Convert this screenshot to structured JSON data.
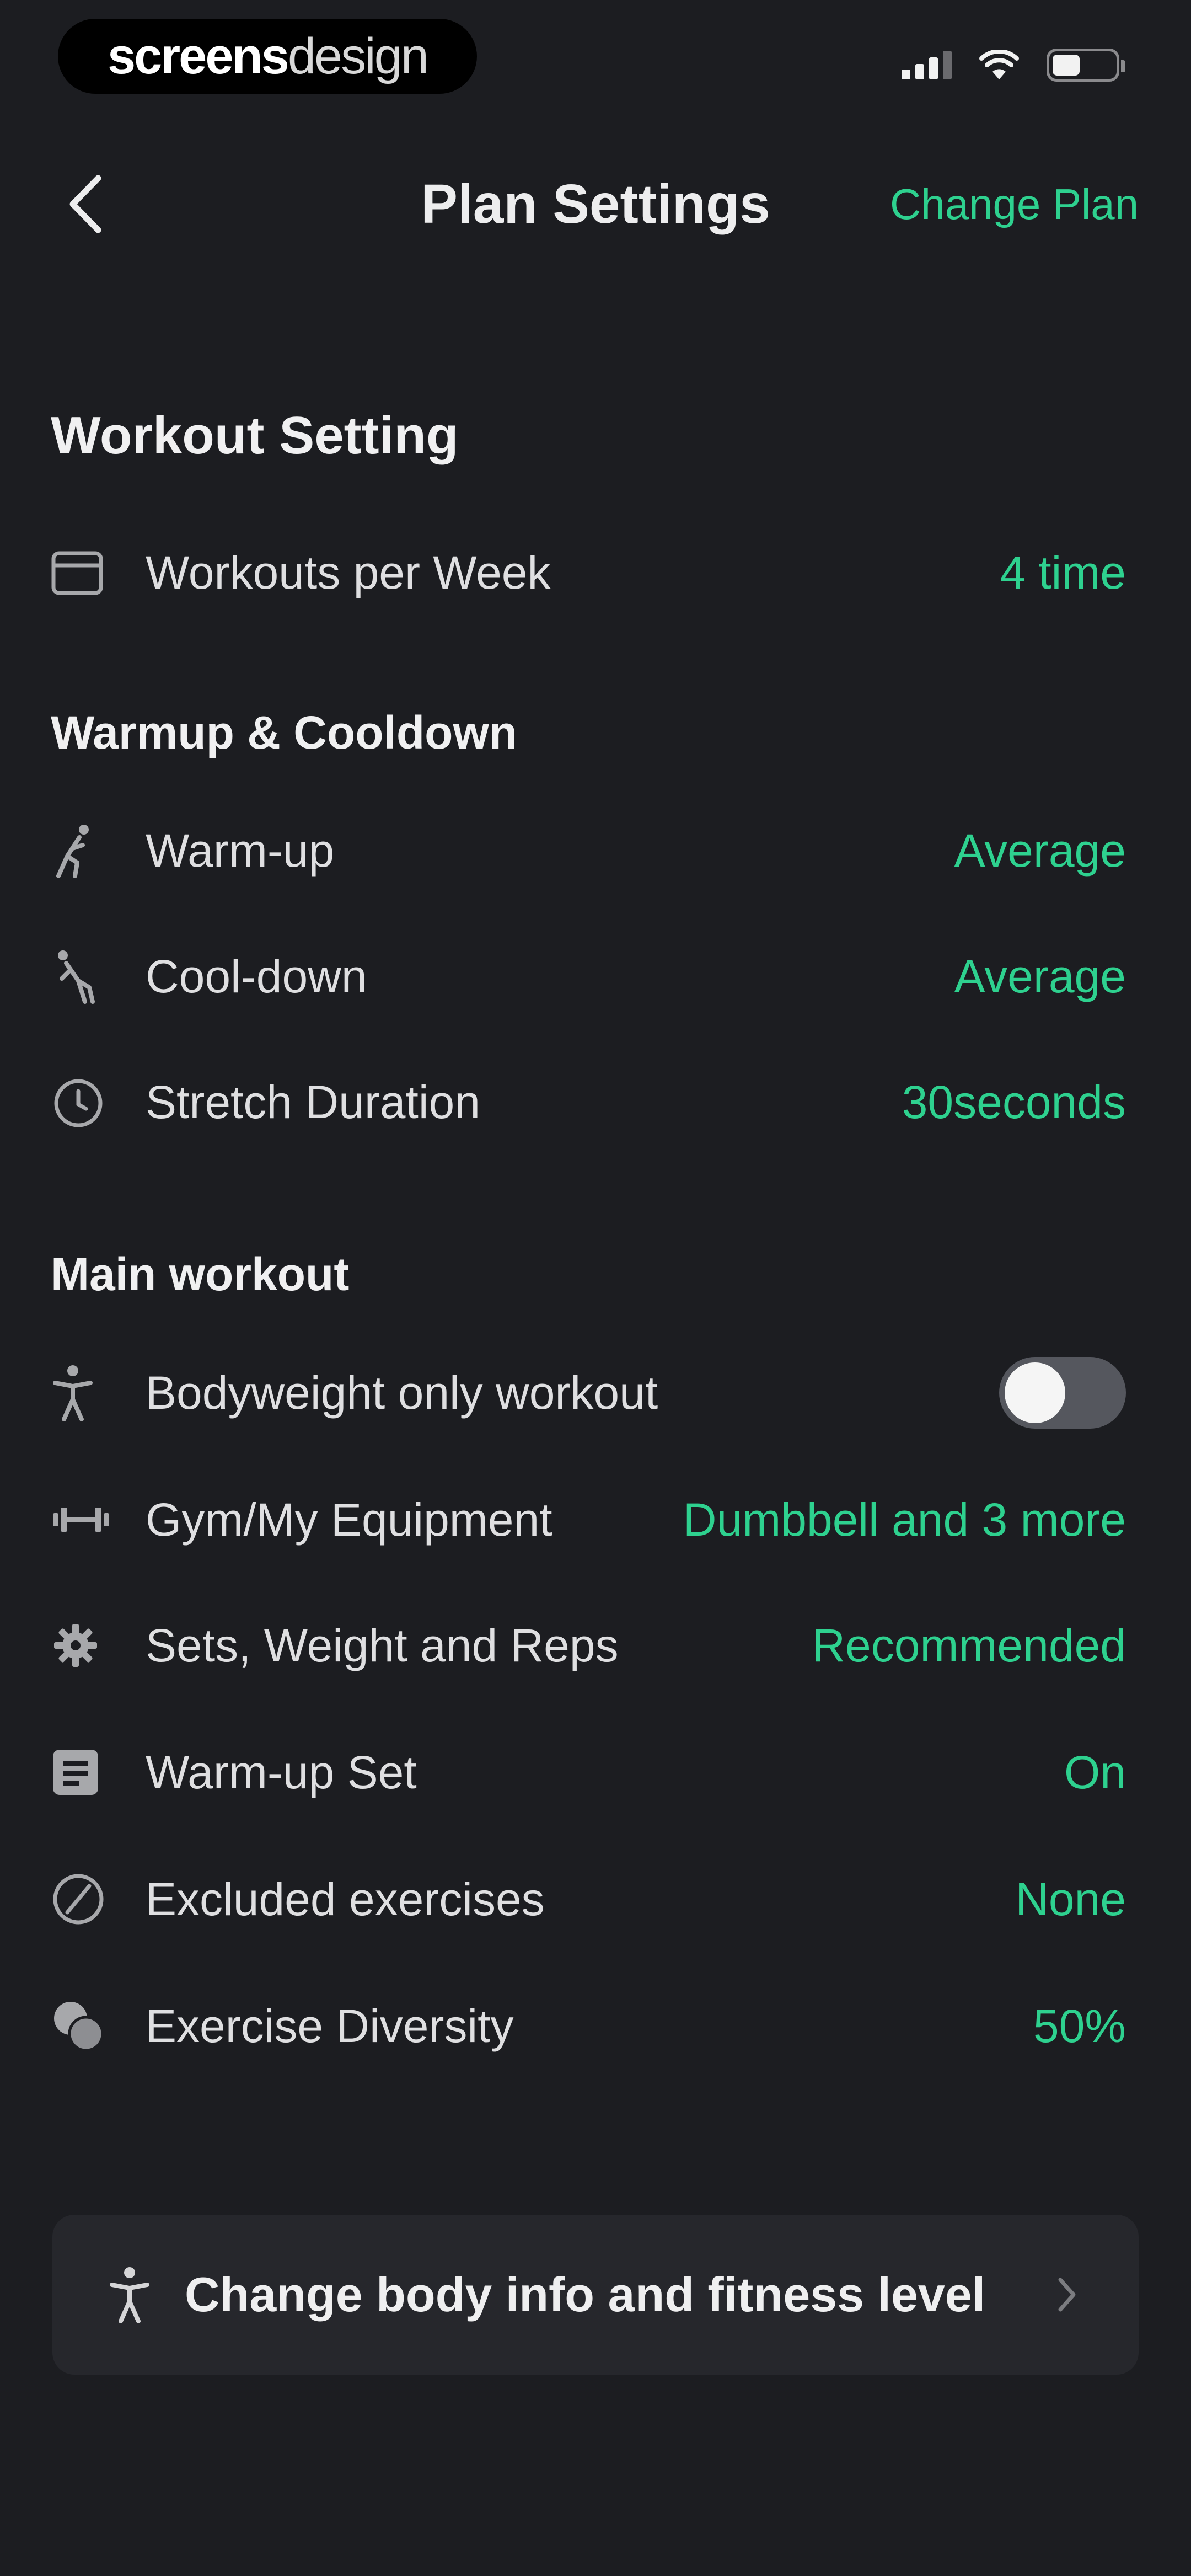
{
  "status_bar": {
    "brand_bold": "screens",
    "brand_light": "design",
    "icons": [
      "signal-icon",
      "wifi-icon",
      "battery-icon"
    ]
  },
  "nav": {
    "title": "Plan Settings",
    "action": "Change Plan",
    "back_icon": "chevron-left-icon"
  },
  "sections": {
    "workout_setting": {
      "title": "Workout Setting",
      "rows": [
        {
          "icon": "calendar-icon",
          "label": "Workouts per Week",
          "value": "4 time"
        }
      ]
    },
    "warmup_cooldown": {
      "title": "Warmup & Cooldown",
      "rows": [
        {
          "icon": "warmup-figure-icon",
          "label": "Warm-up",
          "value": "Average"
        },
        {
          "icon": "cooldown-figure-icon",
          "label": "Cool-down",
          "value": "Average"
        },
        {
          "icon": "timer-icon",
          "label": "Stretch Duration",
          "value": "30seconds"
        }
      ]
    },
    "main_workout": {
      "title": "Main workout",
      "rows": [
        {
          "icon": "person-icon",
          "label": "Bodyweight only workout",
          "toggle_on": false
        },
        {
          "icon": "dumbbell-icon",
          "label": "Gym/My Equipment",
          "value": "Dumbbell and 3 more"
        },
        {
          "icon": "gear-icon",
          "label": "Sets, Weight and Reps",
          "value": "Recommended"
        },
        {
          "icon": "warmup-set-icon",
          "label": "Warm-up Set",
          "value": "On"
        },
        {
          "icon": "block-icon",
          "label": "Excluded exercises",
          "value": "None"
        },
        {
          "icon": "diversity-icon",
          "label": "Exercise Diversity",
          "value": "50%"
        }
      ]
    }
  },
  "body_info_card": {
    "label": "Change body info and fitness level",
    "icon": "person-icon",
    "chevron": "chevron-right-icon"
  },
  "colors": {
    "background": "#1c1d21",
    "accent": "#2ed18f",
    "card": "#26272c",
    "toggle_off": "#55575e"
  }
}
